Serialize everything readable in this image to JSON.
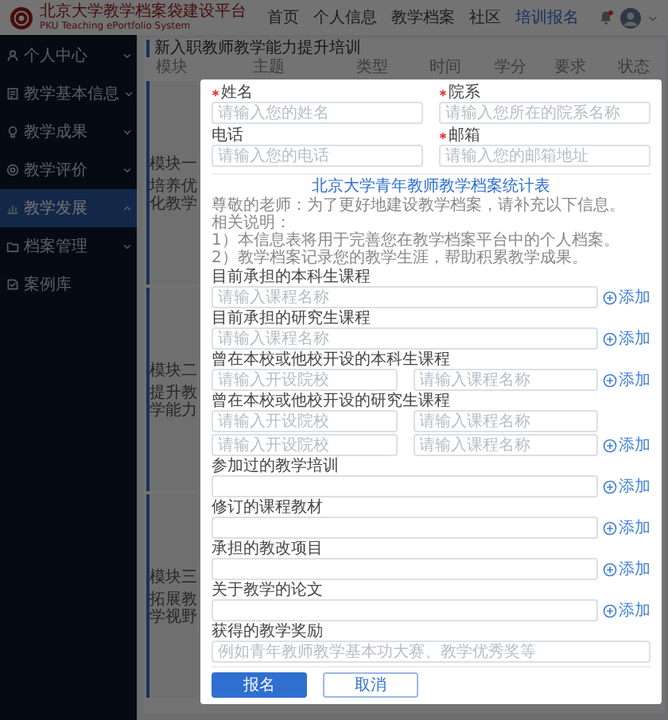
{
  "header": {
    "title": "北京大学教学档案袋建设平台",
    "subtitle": "PKU Teaching ePortfolio System",
    "nav": [
      {
        "label": "首页",
        "selected": false
      },
      {
        "label": "个人信息",
        "selected": false
      },
      {
        "label": "教学档案",
        "selected": false
      },
      {
        "label": "社区",
        "selected": false
      },
      {
        "label": "培训报名",
        "selected": true
      }
    ],
    "notification": true
  },
  "sidebar": {
    "items": [
      {
        "label": "个人中心",
        "selected": false,
        "expanded": false
      },
      {
        "label": "教学基本信息",
        "selected": false,
        "expanded": false
      },
      {
        "label": "教学成果",
        "selected": false,
        "expanded": false
      },
      {
        "label": "教学评价",
        "selected": false,
        "expanded": false
      },
      {
        "label": "教学发展",
        "selected": true,
        "expanded": true
      },
      {
        "label": "档案管理",
        "selected": false,
        "expanded": false
      },
      {
        "label": "案例库",
        "selected": false
      }
    ]
  },
  "page": {
    "title": "新入职教师教学能力提升培训",
    "columns": [
      "模块",
      "主题",
      "类型",
      "时间",
      "学分",
      "要求",
      "状态"
    ],
    "modules": [
      {
        "name": "模块一",
        "subtitle": "培养优化教学"
      },
      {
        "name": "模块二",
        "subtitle": "提升教学能力"
      },
      {
        "name": "模块三",
        "subtitle": "拓展教学视野"
      }
    ]
  },
  "dialog": {
    "fields": [
      {
        "label": "姓名",
        "required": true,
        "placeholder": "请输入您的姓名"
      },
      {
        "label": "院系",
        "required": true,
        "placeholder": "请输入您所在的院系名称"
      },
      {
        "label": "电话",
        "required": false,
        "placeholder": "请输入您的电话"
      },
      {
        "label": "邮箱",
        "required": true,
        "placeholder": "请输入您的邮箱地址"
      }
    ],
    "form_title": "北京大学青年教师教学档案统计表",
    "intro": [
      "尊敬的老师：为了更好地建设教学档案，请补充以下信息。",
      "相关说明：",
      "1）本信息表将用于完善您在教学档案平台中的个人档案。",
      "2）教学档案记录您的教学生涯，帮助积累教学成果。"
    ],
    "sections": [
      {
        "label": "目前承担的本科生课程",
        "rows": [
          [
            {
              "placeholder": "请输入课程名称"
            }
          ]
        ],
        "add": "添加"
      },
      {
        "label": "目前承担的研究生课程",
        "rows": [
          [
            {
              "placeholder": "请输入课程名称"
            }
          ]
        ],
        "add": "添加"
      },
      {
        "label": "曾在本校或他校开设的本科生课程",
        "rows": [
          [
            {
              "placeholder": "请输入开设院校"
            },
            {
              "placeholder": "请输入课程名称"
            }
          ]
        ],
        "add": "添加"
      },
      {
        "label": "曾在本校或他校开设的研究生课程",
        "rows": [
          [
            {
              "placeholder": "请输入开设院校"
            },
            {
              "placeholder": "请输入课程名称"
            }
          ],
          [
            {
              "placeholder": "请输入开设院校"
            },
            {
              "placeholder": "请输入课程名称"
            }
          ]
        ],
        "add": "添加"
      },
      {
        "label": "参加过的教学培训",
        "rows": [
          [
            {}
          ]
        ],
        "add": "添加"
      },
      {
        "label": "修订的课程教材",
        "rows": [
          [
            {}
          ]
        ],
        "add": "添加"
      },
      {
        "label": "承担的教改项目",
        "rows": [
          [
            {}
          ]
        ],
        "add": "添加"
      },
      {
        "label": "关于教学的论文",
        "rows": [
          [
            {}
          ]
        ],
        "add": "添加"
      },
      {
        "label": "获得的教学奖励",
        "rows": [
          [
            {
              "placeholder": "例如青年教师教学基本功大赛、教学优秀奖等"
            }
          ]
        ]
      }
    ],
    "buttons": [
      {
        "label": "报名",
        "kind": "primary"
      },
      {
        "label": "取消",
        "kind": "secondary"
      }
    ]
  }
}
